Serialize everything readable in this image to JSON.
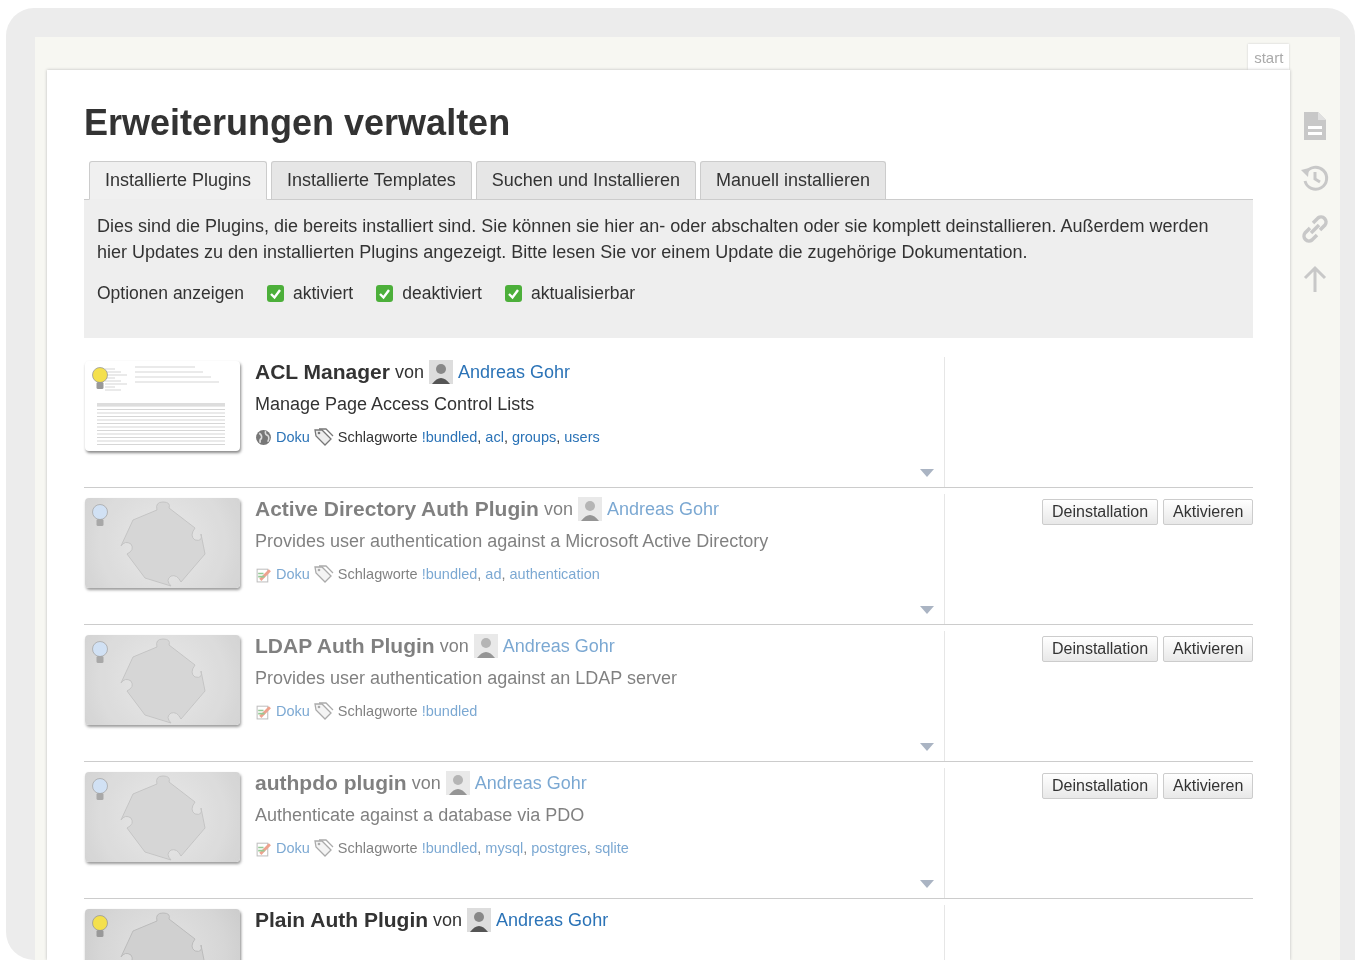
{
  "page_tab": "start",
  "page_title": "Erweiterungen verwalten",
  "tabs": [
    {
      "label": "Installierte Plugins",
      "selected": true
    },
    {
      "label": "Installierte Templates",
      "selected": false
    },
    {
      "label": "Suchen und Installieren",
      "selected": false
    },
    {
      "label": "Manuell installieren",
      "selected": false
    }
  ],
  "intro": "Dies sind die Plugins, die bereits installiert sind. Sie können sie hier an- oder abschalten oder sie komplett deinstallieren. Außerdem werden hier Updates zu den installierten Plugins angezeigt. Bitte lesen Sie vor einem Update die zugehörige Dokumentation.",
  "options": {
    "label": "Optionen anzeigen",
    "items": [
      {
        "label": "aktiviert",
        "checked": true
      },
      {
        "label": "deaktiviert",
        "checked": true
      },
      {
        "label": "aktualisierbar",
        "checked": true
      }
    ]
  },
  "plugins": [
    {
      "name": "ACL Manager",
      "by": "von",
      "author": "Andreas Gohr",
      "description": "Manage Page Access Control Lists",
      "thumbnail": {
        "kind": "screenshot"
      },
      "doc_link": {
        "kind": "globe",
        "label": "Doku"
      },
      "tags_label": "Schlagworte",
      "tags": [
        {
          "label": "!bundled",
          "separator": ","
        },
        {
          "label": "acl",
          "separator": ","
        },
        {
          "label": "groups",
          "separator": ","
        },
        {
          "label": "users"
        }
      ],
      "enabled": true
    },
    {
      "name": "Active Directory Auth Plugin",
      "by": "von",
      "author": "Andreas Gohr",
      "description": "Provides user authentication against a Microsoft Active Directory",
      "thumbnail": {
        "kind": "puzzle"
      },
      "doc_link": {
        "kind": "edit",
        "label": "Doku"
      },
      "tags_label": "Schlagworte",
      "tags": [
        {
          "label": "!bundled",
          "separator": ","
        },
        {
          "label": "ad",
          "separator": ","
        },
        {
          "label": "authentication"
        }
      ],
      "enabled": false,
      "buttons": [
        "Deinstallation",
        "Aktivieren"
      ]
    },
    {
      "name": "LDAP Auth Plugin",
      "by": "von",
      "author": "Andreas Gohr",
      "description": "Provides user authentication against an LDAP server",
      "thumbnail": {
        "kind": "puzzle"
      },
      "doc_link": {
        "kind": "edit",
        "label": "Doku"
      },
      "tags_label": "Schlagworte",
      "tags": [
        {
          "label": "!bundled"
        }
      ],
      "enabled": false,
      "buttons": [
        "Deinstallation",
        "Aktivieren"
      ]
    },
    {
      "name": "authpdo plugin",
      "by": "von",
      "author": "Andreas Gohr",
      "description": "Authenticate against a database via PDO",
      "thumbnail": {
        "kind": "puzzle"
      },
      "doc_link": {
        "kind": "edit",
        "label": "Doku"
      },
      "tags_label": "Schlagworte",
      "tags": [
        {
          "label": "!bundled",
          "separator": ","
        },
        {
          "label": "mysql",
          "separator": ","
        },
        {
          "label": "postgres",
          "separator": ","
        },
        {
          "label": "sqlite"
        }
      ],
      "enabled": false,
      "buttons": [
        "Deinstallation",
        "Aktivieren"
      ]
    },
    {
      "name": "Plain Auth Plugin",
      "by": "von",
      "author": "Andreas Gohr",
      "thumbnail": {
        "kind": "puzzle"
      },
      "enabled": true
    }
  ]
}
